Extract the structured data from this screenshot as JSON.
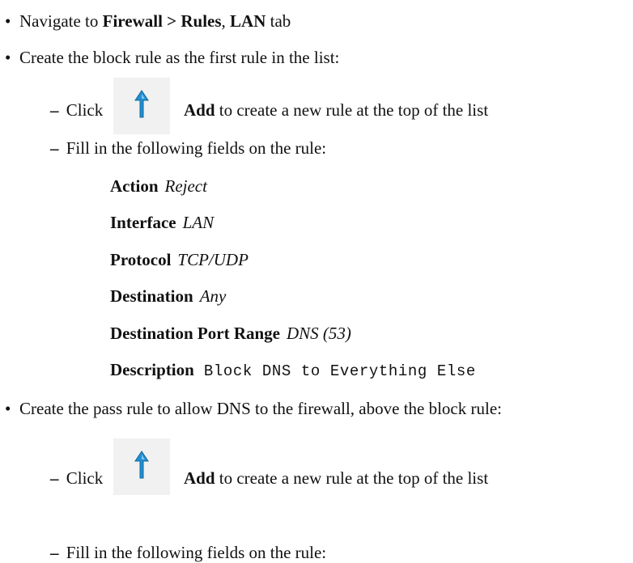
{
  "step1": {
    "bullet": "•",
    "prefix": "Navigate to ",
    "menu_path": "Firewall > Rules",
    "sep": ", ",
    "tab_name": "LAN",
    "suffix": " tab"
  },
  "step2": {
    "bullet": "•",
    "text": "Create the block rule as the first rule in the list:",
    "click": {
      "dash": "–",
      "click_label": "Click",
      "icon": "add-rule-top-icon",
      "add_label": "Add",
      "rest": " to create a new rule at the top of the list"
    },
    "fill": {
      "dash": "–",
      "text": "Fill in the following fields on the rule:"
    },
    "fields": [
      {
        "label": "Action",
        "value": "Reject",
        "mono": false
      },
      {
        "label": "Interface",
        "value": "LAN",
        "mono": false
      },
      {
        "label": "Protocol",
        "value": "TCP/UDP",
        "mono": false
      },
      {
        "label": "Destination",
        "value": "Any",
        "mono": false
      },
      {
        "label": "Destination Port Range",
        "value": "DNS (53)",
        "mono": false
      },
      {
        "label": "Description",
        "value": "Block DNS to Everything Else",
        "mono": true
      }
    ]
  },
  "step3": {
    "bullet": "•",
    "text": "Create the pass rule to allow DNS to the firewall, above the block rule:",
    "click": {
      "dash": "–",
      "click_label": "Click",
      "icon": "add-rule-top-icon",
      "add_label": "Add",
      "rest": " to create a new rule at the top of the list"
    },
    "fill": {
      "dash": "–",
      "text": "Fill in the following fields on the rule:"
    }
  },
  "colors": {
    "icon_background": "#f1f1f1",
    "icon_arrow": "#1f8fd4"
  }
}
